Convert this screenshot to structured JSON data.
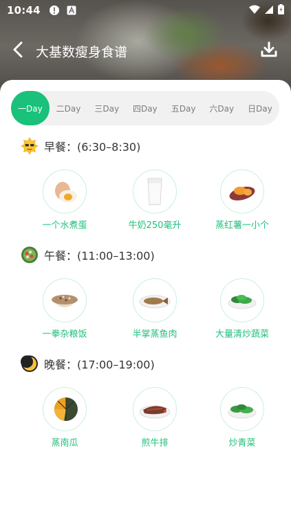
{
  "status": {
    "time": "10:44"
  },
  "header": {
    "title": "大基数瘦身食谱"
  },
  "day_tabs": [
    {
      "label": "一Day",
      "active": true
    },
    {
      "label": "二Day",
      "active": false
    },
    {
      "label": "三Day",
      "active": false
    },
    {
      "label": "四Day",
      "active": false
    },
    {
      "label": "五Day",
      "active": false
    },
    {
      "label": "六Day",
      "active": false
    },
    {
      "label": "日Day",
      "active": false
    }
  ],
  "meals": [
    {
      "label": "早餐：(6:30–8:30)",
      "icon": "sun-sunglasses-icon",
      "foods": [
        {
          "name": "一个水煮蛋",
          "icon": "boiled-egg-icon"
        },
        {
          "name": "牛奶250毫升",
          "icon": "milk-glass-icon"
        },
        {
          "name": "蒸红薯一小个",
          "icon": "sweet-potato-icon"
        }
      ]
    },
    {
      "label": "午餐：(11:00–13:00)",
      "icon": "salad-bowl-icon",
      "foods": [
        {
          "name": "一拳杂粮饭",
          "icon": "grain-rice-icon"
        },
        {
          "name": "半掌蒸鱼肉",
          "icon": "steamed-fish-icon"
        },
        {
          "name": "大量清炒蔬菜",
          "icon": "stir-fried-greens-icon"
        }
      ]
    },
    {
      "label": "晚餐：(17:00–19:00)",
      "icon": "moon-icon",
      "foods": [
        {
          "name": "蒸南瓜",
          "icon": "pumpkin-icon"
        },
        {
          "name": "煎牛排",
          "icon": "steak-icon"
        },
        {
          "name": "炒青菜",
          "icon": "green-vegetables-icon"
        }
      ]
    }
  ]
}
